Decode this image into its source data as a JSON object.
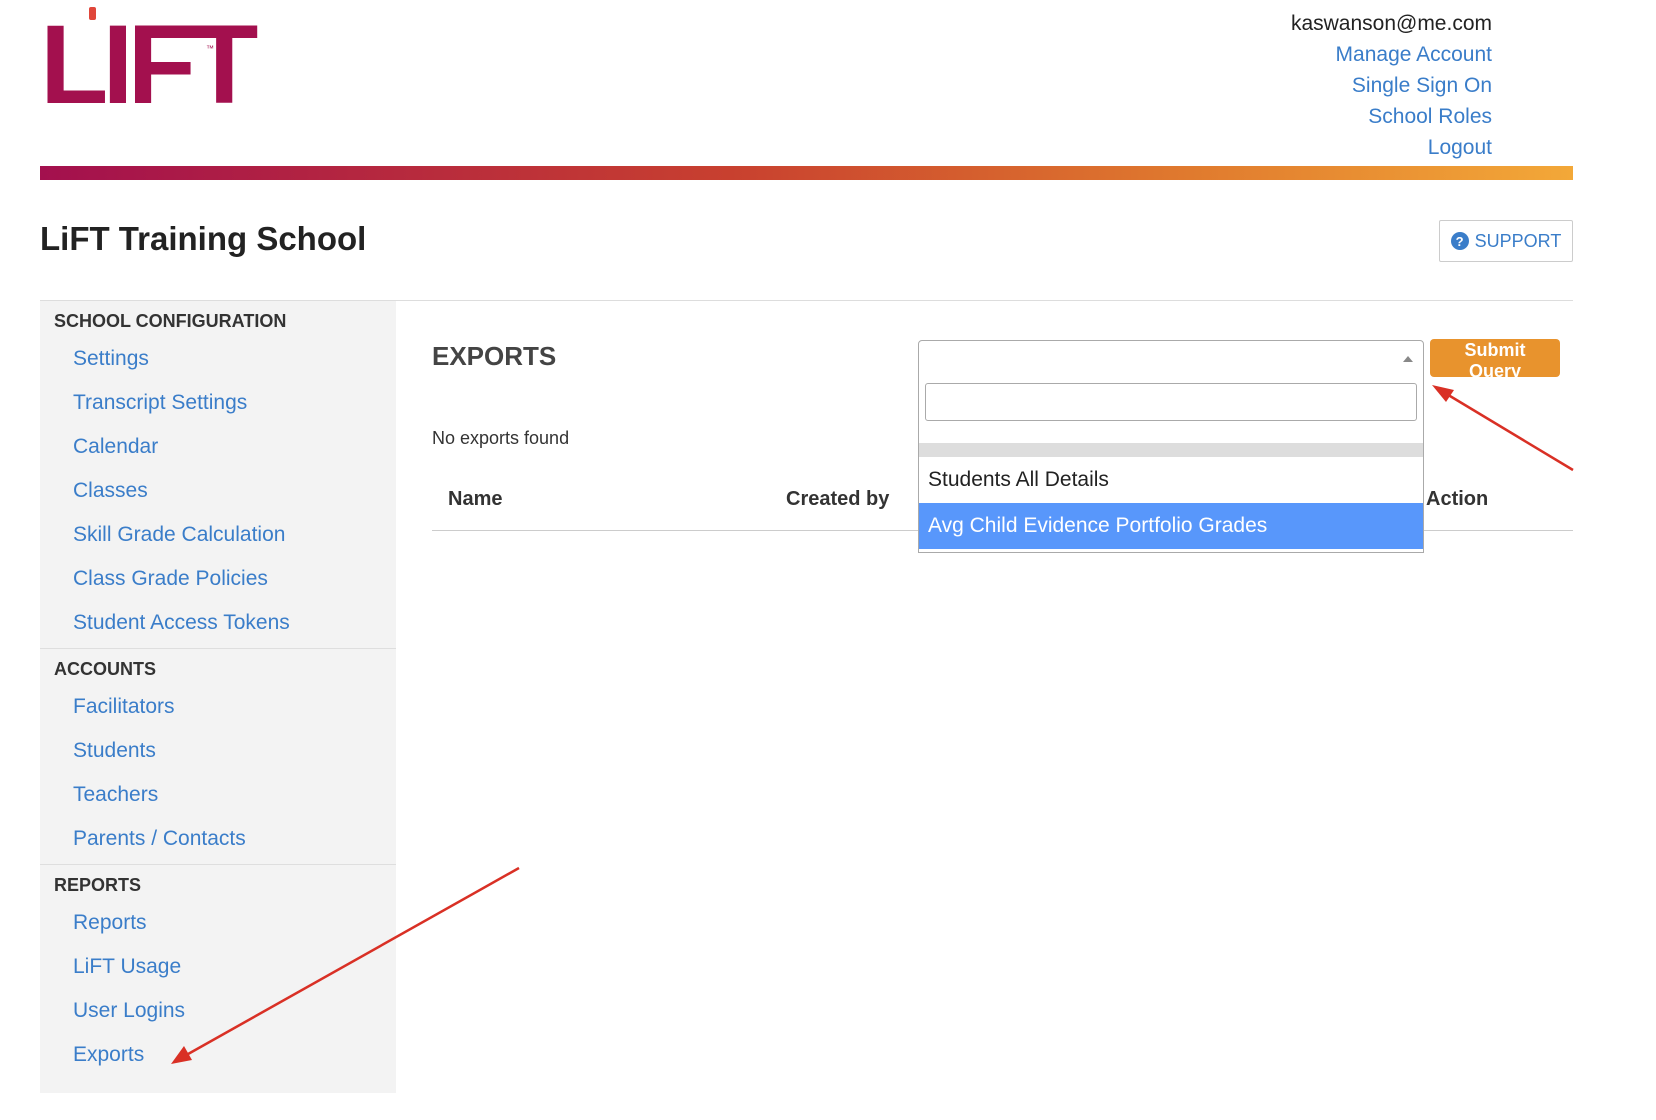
{
  "logo": {
    "text": "LIFT",
    "tm": "™"
  },
  "header": {
    "user_email": "kaswanson@me.com",
    "links": [
      "Manage Account",
      "Single Sign On",
      "School Roles",
      "Logout"
    ]
  },
  "school": {
    "title": "LiFT Training School",
    "support_label": "SUPPORT"
  },
  "sidebar": {
    "sections": [
      {
        "title": "SCHOOL CONFIGURATION",
        "items": [
          "Settings",
          "Transcript Settings",
          "Calendar",
          "Classes",
          "Skill Grade Calculation",
          "Class Grade Policies",
          "Student Access Tokens"
        ]
      },
      {
        "title": "ACCOUNTS",
        "items": [
          "Facilitators",
          "Students",
          "Teachers",
          "Parents / Contacts"
        ]
      },
      {
        "title": "REPORTS",
        "items": [
          "Reports",
          "LiFT Usage",
          "User Logins",
          "Exports"
        ]
      }
    ]
  },
  "main": {
    "title": "EXPORTS",
    "empty_message": "No exports found",
    "columns": [
      "Name",
      "Created by",
      "Action"
    ],
    "submit_label": "Submit Query",
    "select": {
      "value": "",
      "search_value": "",
      "options": [
        "Students All Details",
        "Avg Child Evidence Portfolio Grades"
      ],
      "highlighted_option": "Avg Child Evidence Portfolio Grades"
    }
  },
  "colors": {
    "brand": "#a3104e",
    "link": "#3a7dc9",
    "accent_button": "#e8932d",
    "option_highlight": "#5897fb",
    "annotation_arrow": "#d93025"
  }
}
